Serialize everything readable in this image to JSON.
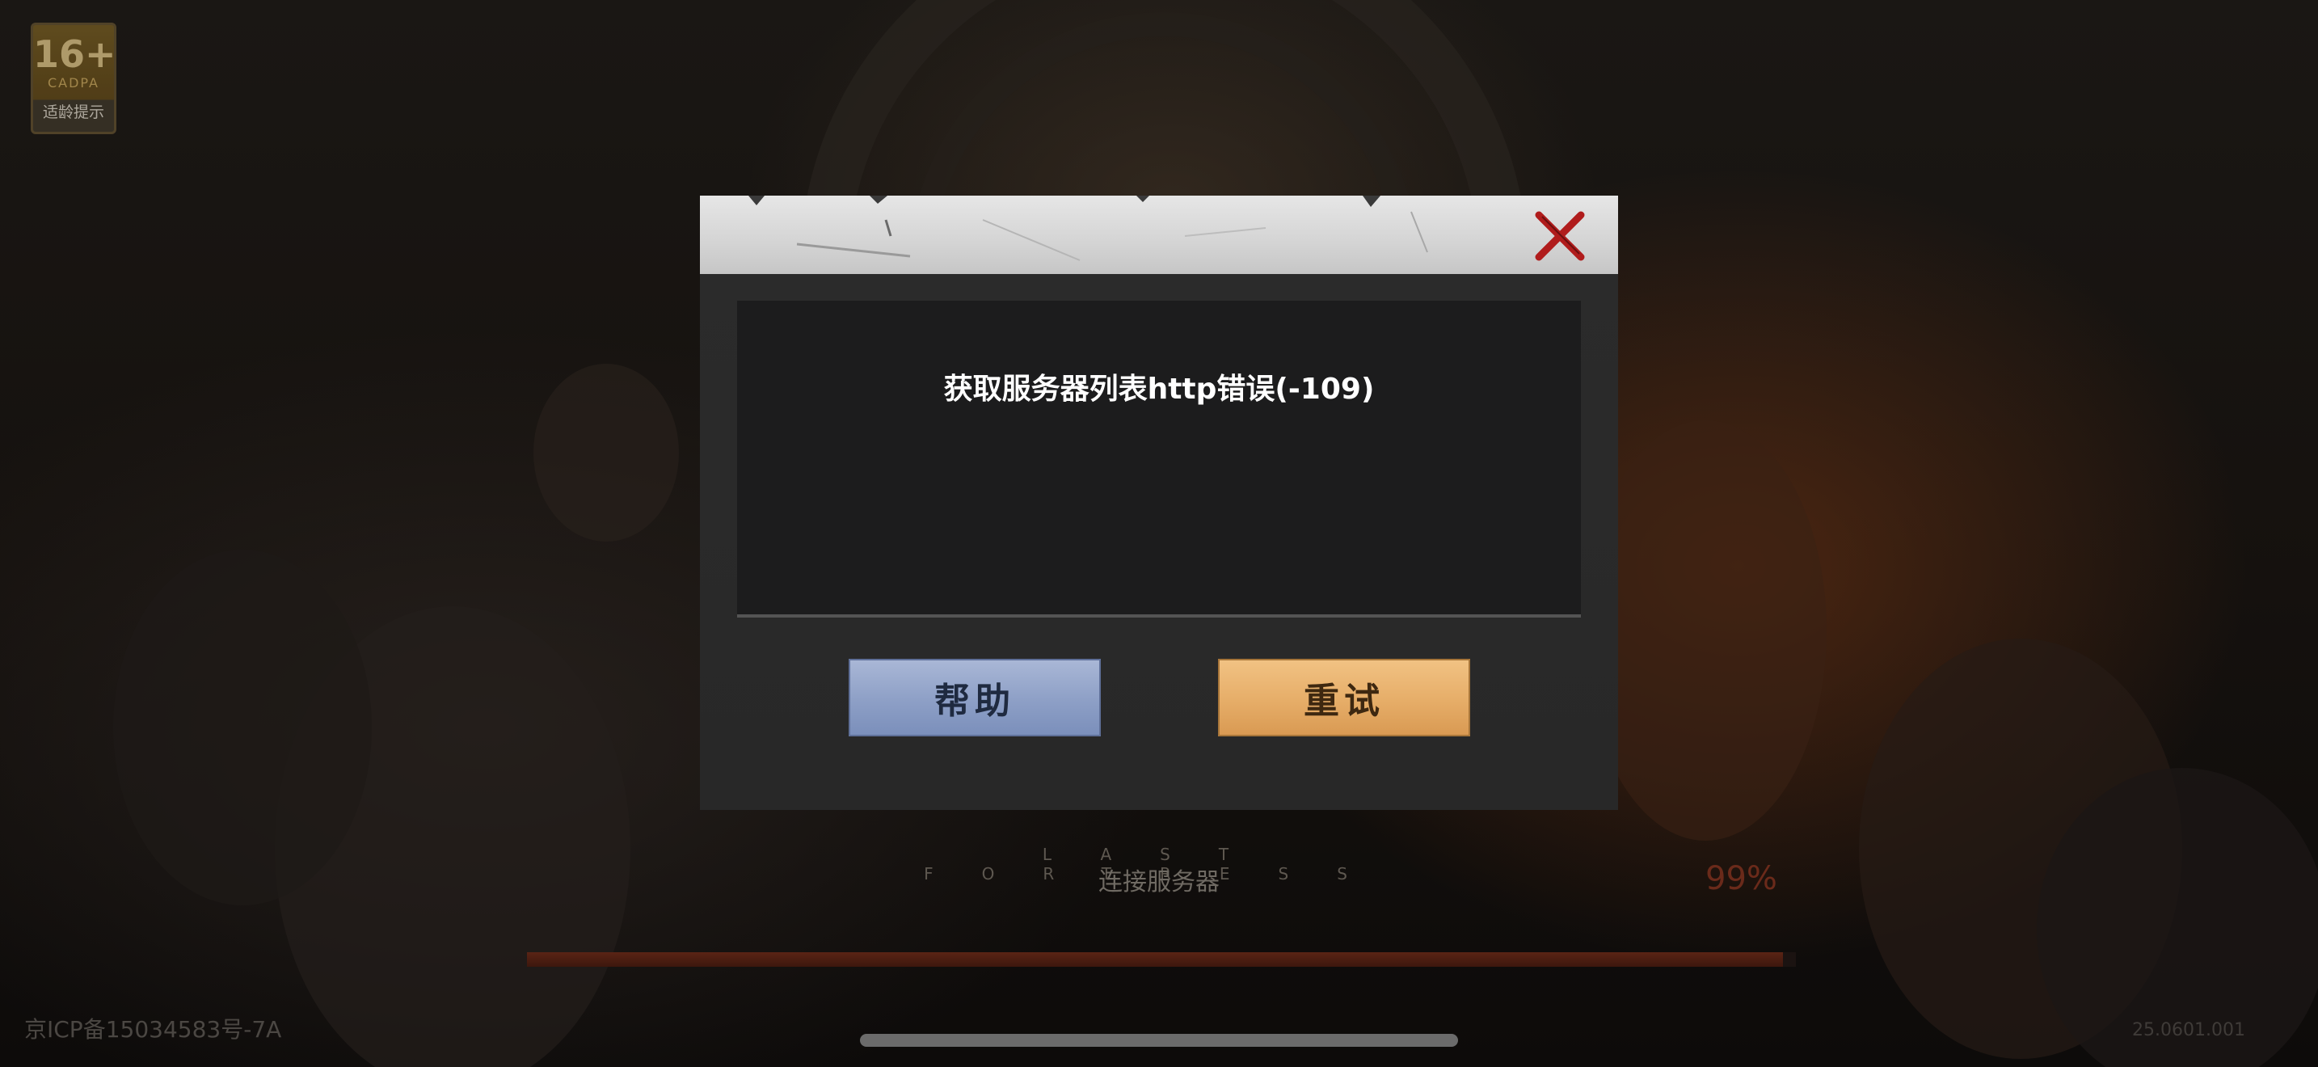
{
  "age_rating": {
    "age": "16+",
    "org": "CADPA",
    "tip": "适龄提示"
  },
  "dialog": {
    "message": "获取服务器列表http错误(-109)",
    "help_label": "帮助",
    "retry_label": "重试",
    "close_icon": "close-x-icon"
  },
  "loading": {
    "status": "连接服务器",
    "percent_label": "99%",
    "progress": 0.99,
    "logo_subtitle": "LAST FORTRESS"
  },
  "footer": {
    "icp": "京ICP备15034583号-7A",
    "version": "25.0601.001"
  },
  "colors": {
    "help_button": "#8d9fc6",
    "retry_button": "#e6ad68",
    "dialog_header": "#d4d4d4",
    "close_icon": "#b01c1c",
    "progress_fill": "#5a2415"
  }
}
